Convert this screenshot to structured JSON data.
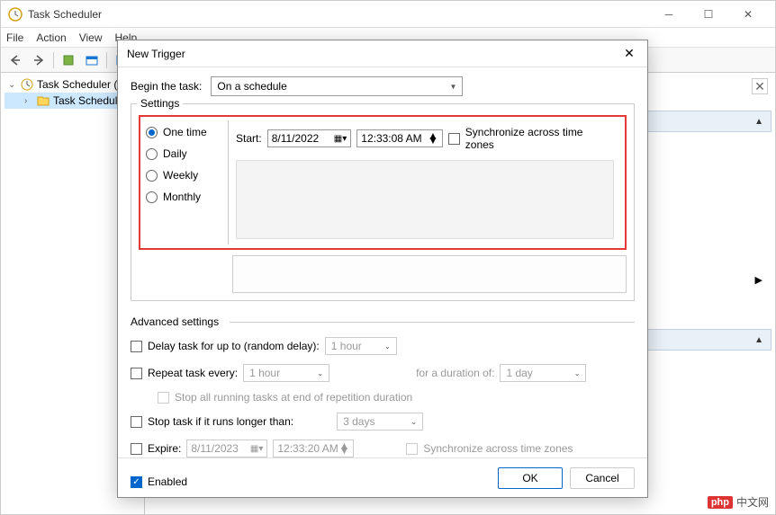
{
  "window": {
    "title": "Task Scheduler",
    "menu": {
      "file": "File",
      "action": "Action",
      "view": "View",
      "help": "Help"
    }
  },
  "tree": {
    "root": "Task Scheduler (L",
    "child": "Task Schedule"
  },
  "dialog": {
    "title": "New Trigger",
    "begin_label": "Begin the task:",
    "begin_value": "On a schedule",
    "settings_legend": "Settings",
    "radios": {
      "one_time": "One time",
      "daily": "Daily",
      "weekly": "Weekly",
      "monthly": "Monthly"
    },
    "start_label": "Start:",
    "start_date": "8/11/2022",
    "start_time": "12:33:08 AM",
    "sync_label": "Synchronize across time zones",
    "advanced_legend": "Advanced settings",
    "delay_label": "Delay task for up to (random delay):",
    "delay_value": "1 hour",
    "repeat_label": "Repeat task every:",
    "repeat_value": "1 hour",
    "duration_label": "for a duration of:",
    "duration_value": "1 day",
    "stop_running_label": "Stop all running tasks at end of repetition duration",
    "stop_longer_label": "Stop task if it runs longer than:",
    "stop_longer_value": "3 days",
    "expire_label": "Expire:",
    "expire_date": "8/11/2023",
    "expire_time": "12:33:20 AM",
    "expire_sync_label": "Synchronize across time zones",
    "enabled_label": "Enabled",
    "ok": "OK",
    "cancel": "Cancel"
  },
  "watermark": {
    "logo": "php",
    "text": "中文网"
  }
}
